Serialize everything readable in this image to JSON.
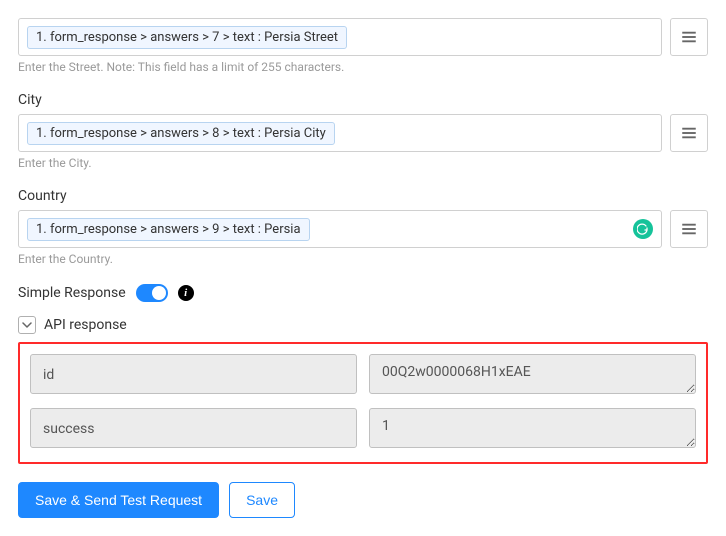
{
  "fields": {
    "street": {
      "value": "1. form_response > answers > 7 > text : Persia Street",
      "helper": "Enter the Street. Note: This field has a limit of 255 characters."
    },
    "city": {
      "label": "City",
      "value": "1. form_response > answers > 8 > text : Persia City",
      "helper": "Enter the City."
    },
    "country": {
      "label": "Country",
      "value": "1. form_response > answers > 9 > text : Persia",
      "helper": "Enter the Country."
    }
  },
  "simple_response": {
    "label": "Simple Response",
    "enabled": true
  },
  "api_response": {
    "title": "API response",
    "rows": [
      {
        "key": "id",
        "value": "00Q2w0000068H1xEAE"
      },
      {
        "key": "success",
        "value": "1"
      }
    ]
  },
  "buttons": {
    "save_send": "Save & Send Test Request",
    "save": "Save"
  }
}
